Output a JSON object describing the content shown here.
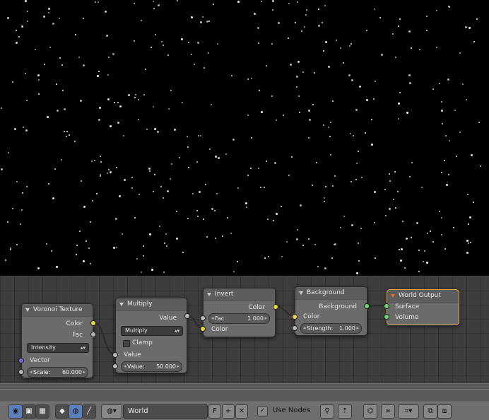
{
  "nodes": {
    "voronoi": {
      "title": "Voronoi Texture",
      "outputs": [
        "Color",
        "Fac"
      ],
      "mode": "Intensity",
      "inputs": {
        "vector": "Vector",
        "scale_label": "Scale:",
        "scale_value": "60.000"
      }
    },
    "multiply": {
      "title": "Multiply",
      "output": "Value",
      "operation": "Multiply",
      "clamp_label": "Clamp",
      "input_value_label": "Value",
      "value_label": "Value:",
      "value_value": "50.000"
    },
    "invert": {
      "title": "Invert",
      "output": "Color",
      "fac_label": "Fac:",
      "fac_value": "1.000",
      "input_color": "Color"
    },
    "background": {
      "title": "Background",
      "output": "Background",
      "input_color": "Color",
      "strength_label": "Strength:",
      "strength_value": "1.000"
    },
    "world_output": {
      "title": "World Output",
      "inputs": [
        "Surface",
        "Volume"
      ]
    }
  },
  "toolbar": {
    "world_name": "World",
    "fake_user": "F",
    "use_nodes_label": "Use Nodes"
  }
}
